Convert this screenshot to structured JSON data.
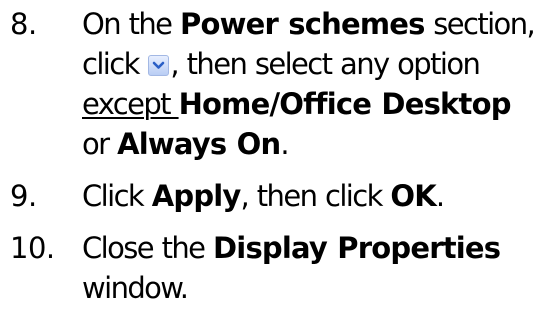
{
  "steps": [
    {
      "number": "8.",
      "lines": [
        {
          "t1": "On the ",
          "b1": "Power schemes",
          "t2": " section,"
        },
        {
          "t1": "click ",
          "icon": "chevron-down-icon",
          "t2": ", then select any option"
        },
        {
          "u1": "except ",
          "b1": "Home/Office Desktop"
        },
        {
          "t1": "or ",
          "b1": "Always On",
          "t2": "."
        }
      ]
    },
    {
      "number": "9.",
      "lines": [
        {
          "t1": "Click ",
          "b1": "Apply",
          "t2": ", then click ",
          "b2": "OK",
          "t3": "."
        }
      ]
    },
    {
      "number": "10.",
      "lines": [
        {
          "t1": "Close the ",
          "b1": "Display Properties"
        },
        {
          "t1": "window."
        }
      ]
    }
  ]
}
